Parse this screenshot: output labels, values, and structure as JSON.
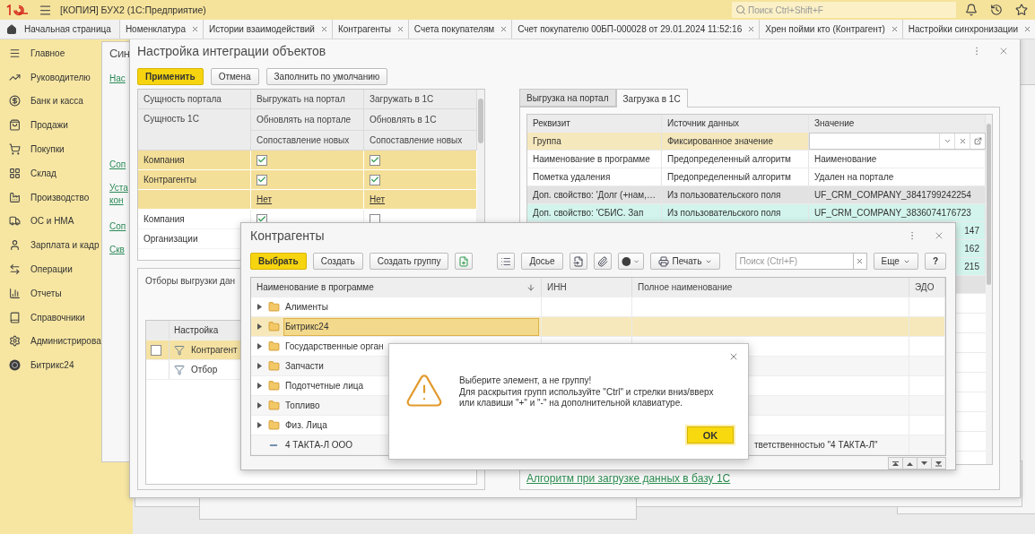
{
  "app": {
    "title": "[КОПИЯ] БУХ2  (1С:Предприятие)",
    "search": {
      "placeholder": "Поиск Ctrl+Shift+F"
    }
  },
  "home_tab": {
    "label": "Начальная страница"
  },
  "tabs": [
    {
      "label": "Номенклатура"
    },
    {
      "label": "Истории взаимодействий"
    },
    {
      "label": "Контрагенты"
    },
    {
      "label": "Счета покупателям"
    },
    {
      "label": "Счет покупателю 00БП-000028 от 29.01.2024 11:52:16"
    },
    {
      "label": "Хрен пойми кто (Контрагент)"
    },
    {
      "label": "Настройки синхронизации"
    }
  ],
  "sidebar": {
    "items": [
      {
        "label": "Главное"
      },
      {
        "label": "Руководителю"
      },
      {
        "label": "Банк и касса"
      },
      {
        "label": "Продажи"
      },
      {
        "label": "Покупки"
      },
      {
        "label": "Склад"
      },
      {
        "label": "Производство"
      },
      {
        "label": "ОС и НМА"
      },
      {
        "label": "Зарплата и кадр"
      },
      {
        "label": "Операции"
      },
      {
        "label": "Отчеты"
      },
      {
        "label": "Справочники"
      },
      {
        "label": "Администрирова"
      },
      {
        "label": "Битрикс24"
      }
    ]
  },
  "sync_window": {
    "title": "Син",
    "links": [
      "Нас",
      "Соп",
      "Уста кон",
      "Соп",
      "Скв"
    ]
  },
  "settings_window": {
    "title": "Настройка интеграции объектов",
    "buttons": [
      {
        "label": "Применить",
        "kind": "primary"
      },
      {
        "label": "Отмена",
        "kind": "normal"
      },
      {
        "label": "Заполнить по умолчанию",
        "kind": "normal"
      }
    ],
    "mapping_table": {
      "columns": [
        {
          "portal": "Сущность портала",
          "entity": "Сущность 1С"
        },
        {
          "enable": "Выгружать на портал",
          "update": "Обновлять на портале",
          "match": "Сопоставление новых"
        },
        {
          "enable": "Загружать в 1С",
          "update": "Обновлять в 1С",
          "match": "Сопоставление новых"
        }
      ],
      "groups": [
        {
          "selected": true,
          "portal": "Компания",
          "entity": "Контрагенты",
          "export": {
            "enabled": true,
            "update": true,
            "match": "Нет"
          },
          "import": {
            "enabled": true,
            "update": true,
            "match": "Нет"
          }
        },
        {
          "selected": false,
          "portal": "Компания",
          "entity": "Организации",
          "export": {
            "enabled": true
          },
          "import": {
            "enabled": false
          }
        }
      ]
    },
    "filters": {
      "title": "Отборы выгрузки дан",
      "column": "Настройка",
      "rows": [
        {
          "label": "Контрагент",
          "checked": false,
          "selected": true
        },
        {
          "label": "Отбор",
          "selected": false
        }
      ]
    },
    "details": {
      "tabs": [
        {
          "label": "Выгрузка на портал",
          "selected": false
        },
        {
          "label": "Загрузка в 1С",
          "selected": true
        }
      ],
      "columns": [
        "Реквизит",
        "Источник данных",
        "Значение"
      ],
      "rows": [
        {
          "kind": "field",
          "color": "#f6e8bd",
          "attribute": "Группа",
          "source": "Фиксированное значение"
        },
        {
          "kind": "text",
          "color": "#ffffff",
          "attribute": "Наименование в программе",
          "source": "Предопределенный алгоритм",
          "value": "Наименование"
        },
        {
          "kind": "text",
          "color": "#ffffff",
          "attribute": "Пометка удаления",
          "source": "Предопределенный алгоритм",
          "value": "Удален на портале"
        },
        {
          "kind": "text",
          "color": "#e2e2e2",
          "attribute": "Доп. свойство: 'Долг (+нам,…",
          "source": "Из пользовательского поля",
          "value": "UF_CRM_COMPANY_3841799242254"
        },
        {
          "kind": "text",
          "color": "#d2f4ec",
          "attribute": "Доп. свойство: 'СБИС. Зап",
          "source": "Из пользовательского поля",
          "value": "UF_CRM_COMPANY_3836074176723"
        },
        {
          "kind": "tail",
          "color": "#d2f4ec",
          "value": "147"
        },
        {
          "kind": "tail",
          "color": "#d2f4ec",
          "value": "162"
        },
        {
          "kind": "tail",
          "color": "#d2f4ec",
          "value": "215"
        },
        {
          "kind": "blank",
          "color": "#e2e2e2"
        }
      ],
      "link": "Алгоритм при загрузке данных в базу 1С"
    }
  },
  "kontragenty": {
    "title": "Контрагенты",
    "toolbar": {
      "select": "Выбрать",
      "create": "Создать",
      "create_group": "Создать группу",
      "dossier": "Досье",
      "print": "Печать",
      "search_placeholder": "Поиск (Ctrl+F)",
      "more": "Еще",
      "help": "?"
    },
    "columns": [
      "Наименование в программе",
      "ИНН",
      "Полное наименование",
      "ЭДО"
    ],
    "rows": [
      {
        "kind": "group",
        "name": "Алименты",
        "selected": false
      },
      {
        "kind": "group",
        "name": "Битрикс24",
        "selected": true
      },
      {
        "kind": "group",
        "name": "Государственные орган",
        "selected": false
      },
      {
        "kind": "group",
        "name": "Запчасти",
        "selected": false
      },
      {
        "kind": "group",
        "name": "Подотчетные лица",
        "selected": false
      },
      {
        "kind": "group",
        "name": "Топливо",
        "selected": false
      },
      {
        "kind": "group",
        "name": "Физ. Лица",
        "selected": false
      },
      {
        "kind": "item",
        "name": "4 ТАКТА-Л ООО",
        "full_name": "тветственностью \"4 ТАКТА-Л\"",
        "selected": false
      }
    ]
  },
  "alert": {
    "message": "Выберите элемент, а не группу!\nДля раскрытия групп используйте \"Ctrl\" и стрелки вниз/вверх\nили клавиши \"+\" и \"-\" на дополнительной клавиатуре.",
    "button": "OK"
  }
}
